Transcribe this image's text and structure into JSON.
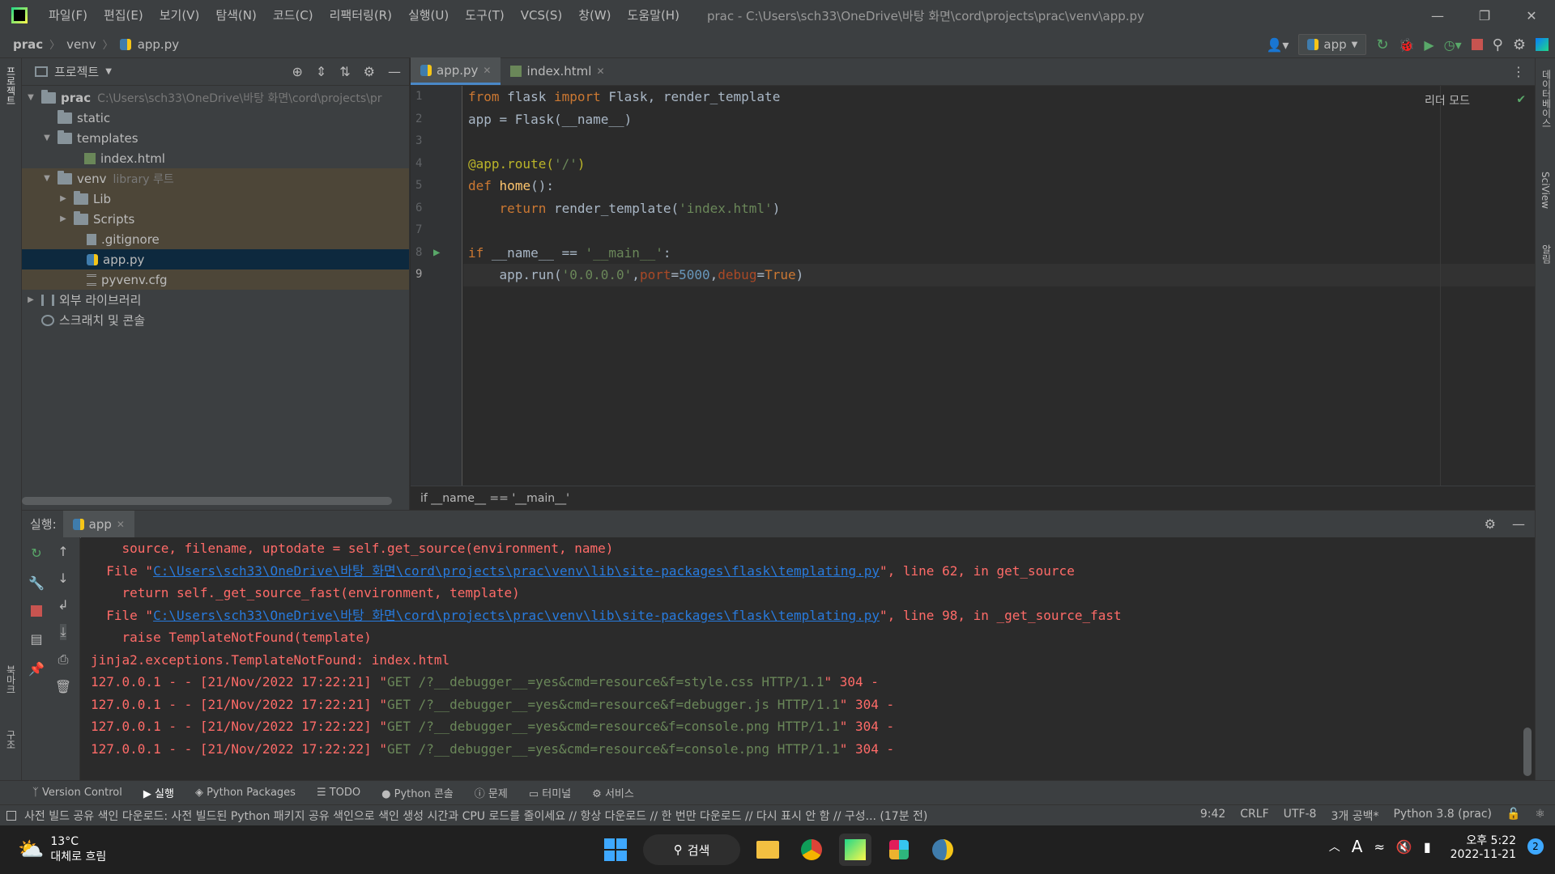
{
  "menu": [
    "파일(F)",
    "편집(E)",
    "보기(V)",
    "탐색(N)",
    "코드(C)",
    "리팩터링(R)",
    "실행(U)",
    "도구(T)",
    "VCS(S)",
    "창(W)",
    "도움말(H)"
  ],
  "window_title": "prac - C:\\Users\\sch33\\OneDrive\\바탕 화면\\cord\\projects\\prac\\venv\\app.py",
  "nav": {
    "crumb1": "prac",
    "crumb2": "venv",
    "crumb3": "app.py",
    "run_config": "app"
  },
  "project": {
    "title": "프로젝트",
    "root": "prac",
    "root_path": "C:\\Users\\sch33\\OneDrive\\바탕 화면\\cord\\projects\\pr",
    "static": "static",
    "templates": "templates",
    "index": "index.html",
    "venv": "venv",
    "venv_hint": "library 루트",
    "lib": "Lib",
    "scripts": "Scripts",
    "gitignore": ".gitignore",
    "app": "app.py",
    "pyvenv": "pyvenv.cfg",
    "ext_lib": "외부 라이브러리",
    "scratch": "스크래치 및 콘솔"
  },
  "tabs": [
    {
      "label": "app.py"
    },
    {
      "label": "index.html"
    }
  ],
  "reader_mode": "리더 모드",
  "code_breadcrumb": "if __name__ == '__main__'",
  "left_strip": {
    "project": "프로젝트",
    "bookmarks": "북마크",
    "structure": "구조"
  },
  "right_strip": {
    "db": "데이터베이스",
    "sciview": "SciView",
    "notif": "알림"
  },
  "run": {
    "label": "실행:",
    "tab": "app"
  },
  "console": {
    "l1": "    source, filename, uptodate = self.get_source(environment, name)",
    "l2a": "  File \"",
    "l2link": "C:\\Users\\sch33\\OneDrive\\바탕 화면\\cord\\projects\\prac\\venv\\lib\\site-packages\\flask\\templating.py",
    "l2b": "\", line 62, in get_source",
    "l3": "    return self._get_source_fast(environment, template)",
    "l4a": "  File \"",
    "l4link": "C:\\Users\\sch33\\OneDrive\\바탕 화면\\cord\\projects\\prac\\venv\\lib\\site-packages\\flask\\templating.py",
    "l4b": "\", line 98, in _get_source_fast",
    "l5": "    raise TemplateNotFound(template)",
    "l6": "jinja2.exceptions.TemplateNotFound: index.html",
    "log1a": "127.0.0.1 - - [21/Nov/2022 17:22:21] \"",
    "log1b": "GET /?__debugger__=yes&cmd=resource&f=style.css HTTP/1.1",
    "log1c": "\" 304 -",
    "log2a": "127.0.0.1 - - [21/Nov/2022 17:22:21] \"",
    "log2b": "GET /?__debugger__=yes&cmd=resource&f=debugger.js HTTP/1.1",
    "log2c": "\" 304 -",
    "log3a": "127.0.0.1 - - [21/Nov/2022 17:22:22] \"",
    "log3b": "GET /?__debugger__=yes&cmd=resource&f=console.png HTTP/1.1",
    "log3c": "\" 304 -",
    "log4a": "127.0.0.1 - - [21/Nov/2022 17:22:22] \"",
    "log4b": "GET /?__debugger__=yes&cmd=resource&f=console.png HTTP/1.1",
    "log4c": "\" 304 -"
  },
  "tooltabs": [
    "Version Control",
    "실행",
    "Python Packages",
    "TODO",
    "Python 콘솔",
    "문제",
    "터미널",
    "서비스"
  ],
  "status": {
    "message": "사전 빌드 공유 색인 다운로드: 사전 빌드된 Python 패키지 공유 색인으로 색인 생성 시간과 CPU 로드를 줄이세요 // 항상 다운로드 // 한 번만 다운로드 // 다시 표시 안 함 // 구성... (17분 전)",
    "pos": "9:42",
    "eol": "CRLF",
    "enc": "UTF-8",
    "indent": "3개 공백*",
    "interp": "Python 3.8 (prac)"
  },
  "taskbar": {
    "temp": "13°C",
    "weather": "대체로 흐림",
    "search": "검색",
    "time": "오후 5:22",
    "date": "2022-11-21",
    "badge": "2"
  }
}
